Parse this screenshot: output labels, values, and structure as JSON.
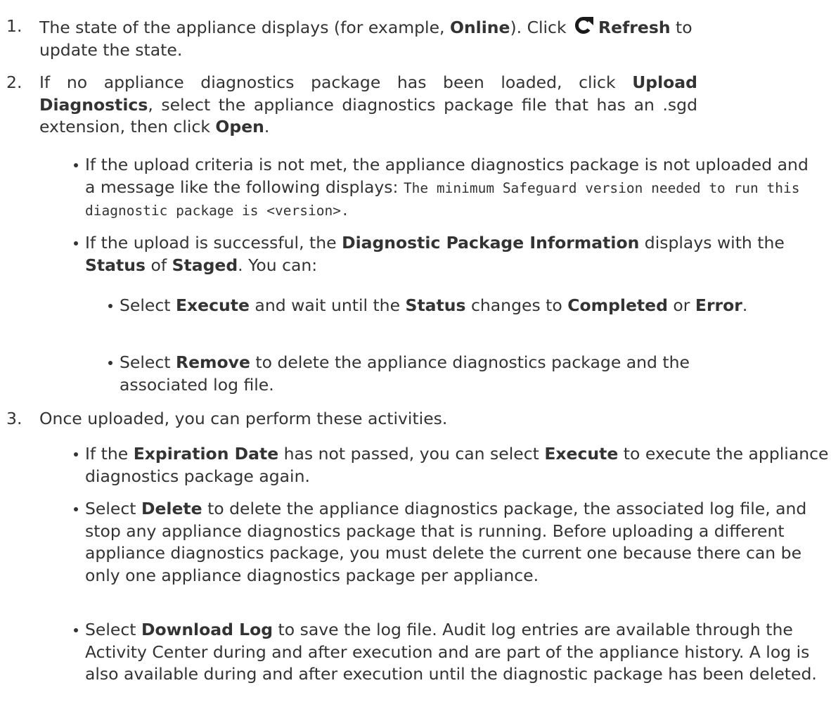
{
  "steps": [
    {
      "number": "1.",
      "line1_a": "The state of the appliance displays (for example, ",
      "line1_b": "Online",
      "line1_c": "). Click ",
      "icon": "refresh-icon",
      "line1_d": "Refresh",
      "line1_e": " to",
      "line2": "update the state."
    },
    {
      "number": "2.",
      "t1": "If no appliance diagnostics package has been loaded, click ",
      "b1": "Upload Diagnostics",
      "t2": ", select the appliance diagnostics package file that has an .sgd extension, then click ",
      "b2": "Open",
      "t3": ".",
      "bullets": [
        {
          "t1": "If the upload criteria is not met, the appliance diagnostics package is not uploaded and a message like the following displays: ",
          "code": "The minimum Safeguard version needed to run this diagnostic package is <version>."
        },
        {
          "t1": "If the upload is successful, the ",
          "b1": "Diagnostic Package Information",
          "t2": " displays with the ",
          "b2": "Status",
          "t3": " of ",
          "b3": "Staged",
          "t4": ". You can:",
          "sub": [
            {
              "t1": "Select ",
              "b1": "Execute",
              "t2": " and wait until the ",
              "b2": "Status",
              "t3": " changes to ",
              "b3": "Completed",
              "t4": " or ",
              "b4": "Error",
              "t5": "."
            },
            {
              "t1": "Select ",
              "b1": "Remove",
              "t2": " to delete the appliance diagnostics package and the associated log file."
            }
          ]
        }
      ]
    },
    {
      "number": "3.",
      "text": "Once uploaded, you can perform these activities.",
      "bullets": [
        {
          "t1": "If the ",
          "b1": "Expiration Date",
          "t2": " has not passed, you can select ",
          "b2": "Execute",
          "t3": " to execute the appliance diagnostics package again."
        },
        {
          "t1": "Select ",
          "b1": "Delete",
          "t2": " to delete the appliance diagnostics package, the associated log file, and stop any appliance diagnostics package that is running. Before uploading a different appliance diagnostics package, you must delete the current one because there can be only one appliance diagnostics package per appliance."
        },
        {
          "t1": "Select ",
          "b1": "Download Log",
          "t2": " to save the log file. Audit log entries are available through the Activity Center during and after execution and are part of the appliance history. A log is also available during and after execution until the diagnostic package has been deleted."
        }
      ]
    }
  ]
}
